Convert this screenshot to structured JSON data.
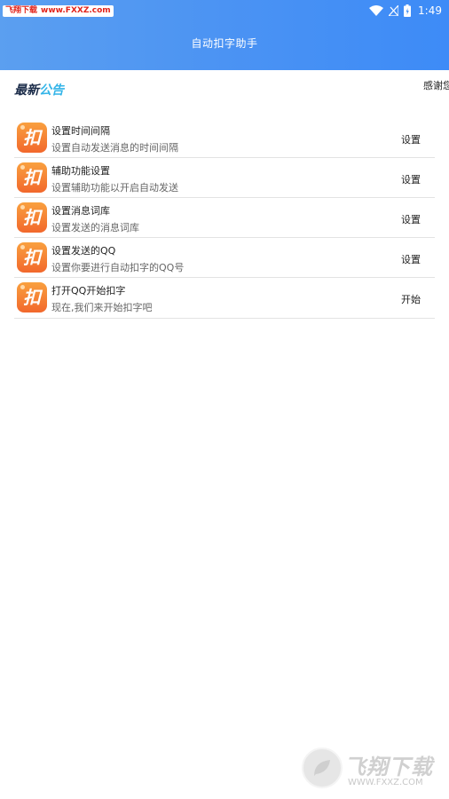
{
  "status_bar": {
    "watermark_red": "飞翔下载",
    "watermark_url": "www.FXXZ.com",
    "time": "1:49",
    "icons": [
      "wifi-icon",
      "signal-icon",
      "battery-icon"
    ]
  },
  "app_bar": {
    "title": "自动扣字助手"
  },
  "notice": {
    "logo_part1": "最新",
    "logo_part2": "公告",
    "marquee_text": "感谢您"
  },
  "list": {
    "items": [
      {
        "title": "设置时间间隔",
        "desc": "设置自动发送消息的时间间隔",
        "action": "设置",
        "icon_glyph": "扣"
      },
      {
        "title": "辅助功能设置",
        "desc": "设置辅助功能以开启自动发送",
        "action": "设置",
        "icon_glyph": "扣"
      },
      {
        "title": "设置消息词库",
        "desc": "设置发送的消息词库",
        "action": "设置",
        "icon_glyph": "扣"
      },
      {
        "title": "设置发送的QQ",
        "desc": "设置你要进行自动扣字的QQ号",
        "action": "设置",
        "icon_glyph": "扣"
      },
      {
        "title": "打开QQ开始扣字",
        "desc": "现在,我们来开始扣字吧",
        "action": "开始",
        "icon_glyph": "扣"
      }
    ]
  },
  "watermark_bottom": {
    "cn": "飞翔下载",
    "url": "WWW.FXXZ.COM"
  },
  "colors": {
    "header_gradient_start": "#5b9ff0",
    "header_gradient_end": "#3d8bf7",
    "icon_orange": "#f2682c",
    "notice_blue": "#33b4e8"
  }
}
